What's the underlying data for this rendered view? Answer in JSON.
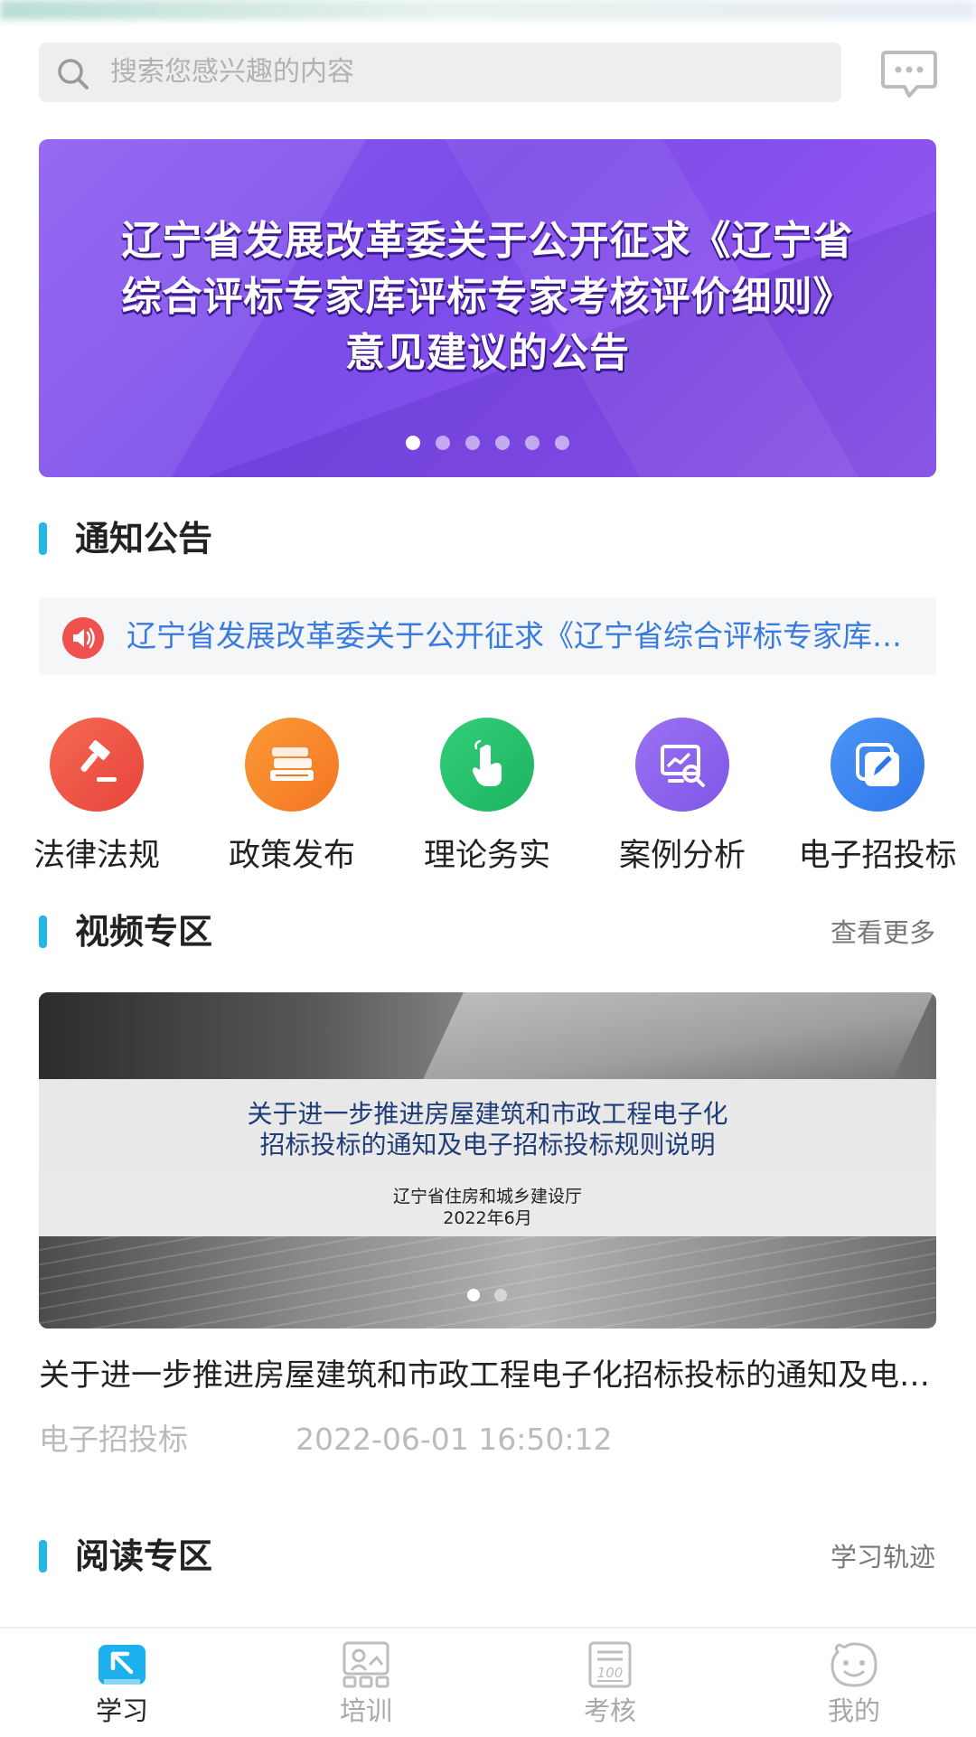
{
  "search": {
    "placeholder": "搜索您感兴趣的内容"
  },
  "icons": {
    "search": "search-icon",
    "message": "message-icon",
    "speaker": "speaker-icon"
  },
  "banner": {
    "title_lines": [
      "辽宁省发展改革委关于公开征求《辽宁省",
      "综合评标专家库评标专家考核评价细则》",
      "意见建议的公告"
    ],
    "slide_count": 6,
    "active_slide": 1,
    "background_color": "#8a56ee"
  },
  "notice_section": {
    "title": "通知公告",
    "ticker_text": "辽宁省发展改革委关于公开征求《辽宁省综合评标专家库评标专家考核评价细则》意见建议的公告"
  },
  "categories": [
    {
      "label": "法律法规",
      "icon": "gavel-icon",
      "color": "#ef4f45"
    },
    {
      "label": "政策发布",
      "icon": "books-icon",
      "color": "#f7842a"
    },
    {
      "label": "理论务实",
      "icon": "touch-icon",
      "color": "#25c06a"
    },
    {
      "label": "案例分析",
      "icon": "analysis-icon",
      "color": "#8a63ec"
    },
    {
      "label": "电子招投标",
      "icon": "edit-icon",
      "color": "#3d86f0"
    }
  ],
  "video_section": {
    "title": "视频专区",
    "more_label": "查看更多",
    "card": {
      "poster_title_lines": [
        "关于进一步推进房屋建筑和市政工程电子化",
        "招标投标的通知及电子招标投标规则说明"
      ],
      "poster_org": "辽宁省住房和城乡建设厅",
      "poster_date": "2022年6月",
      "slide_count": 2,
      "active_slide": 1
    },
    "caption": "关于进一步推进房屋建筑和市政工程电子化招标投标的通知及电子招标投标规则说明",
    "category": "电子招投标",
    "datetime": "2022-06-01 16:50:12"
  },
  "reading_section": {
    "title": "阅读专区",
    "more_label": "学习轨迹"
  },
  "tabs": [
    {
      "label": "学习",
      "icon": "study-icon",
      "active": true
    },
    {
      "label": "培训",
      "icon": "training-icon",
      "active": false
    },
    {
      "label": "考核",
      "icon": "exam-icon",
      "active": false
    },
    {
      "label": "我的",
      "icon": "profile-icon",
      "active": false
    }
  ],
  "colors": {
    "accent": "#22b7e6",
    "link": "#3a7be0",
    "muted_text": "#bbbbbb"
  }
}
